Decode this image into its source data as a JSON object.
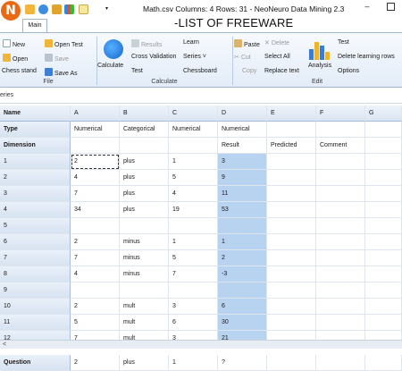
{
  "window": {
    "title": "Math.csv Columns: 4 Rows: 31 - NeoNeuro Data Mining 2.3",
    "app_icon_letter": "N",
    "minimize_glyph": "–",
    "banner": "-LIST OF FREEWARE"
  },
  "tabs": [
    {
      "label": "Main"
    }
  ],
  "ribbon": {
    "file": {
      "label": "File",
      "new": "New",
      "open_test": "Open Test",
      "open": "Open",
      "save": "Save",
      "chess_stand": "Chess stand",
      "save_as": "Save As"
    },
    "calculate": {
      "label": "Calculate",
      "calculate": "Calculate",
      "results": "Results",
      "cross_validation": "Cross Validation",
      "test": "Test",
      "learn": "Learn",
      "series": "Series ˅",
      "chessboard": "Chessboard"
    },
    "edit": {
      "label": "Edit",
      "paste": "Paste",
      "delete": "Delete",
      "cut": "Cut",
      "select_all": "Select All",
      "copy": "Copy",
      "replace_text": "Replace text",
      "analysis": "Analysis",
      "test": "Test",
      "delete_learning_rows": "Delete learning rows",
      "options": "Options"
    }
  },
  "formula_bar": {
    "text": "eries"
  },
  "grid": {
    "columns": [
      "Name",
      "A",
      "B",
      "C",
      "D",
      "E",
      "F",
      "G"
    ],
    "type_row": [
      "Type",
      "Numerical",
      "Categorical",
      "Numerical",
      "Numerical",
      "",
      "",
      ""
    ],
    "dimension_row": [
      "Dimension",
      "",
      "",
      "",
      "Result",
      "Predicted",
      "Comment",
      ""
    ],
    "rows": [
      [
        "1",
        "2",
        "plus",
        "1",
        "3"
      ],
      [
        "2",
        "4",
        "plus",
        "5",
        "9"
      ],
      [
        "3",
        "7",
        "plus",
        "4",
        "11"
      ],
      [
        "4",
        "34",
        "plus",
        "19",
        "53"
      ],
      [
        "5",
        "",
        "",
        "",
        ""
      ],
      [
        "6",
        "2",
        "minus",
        "1",
        "1"
      ],
      [
        "7",
        "7",
        "minus",
        "5",
        "2"
      ],
      [
        "8",
        "4",
        "minus",
        "7",
        "-3"
      ],
      [
        "9",
        "",
        "",
        "",
        ""
      ],
      [
        "10",
        "2",
        "mult",
        "3",
        "6"
      ],
      [
        "11",
        "5",
        "mult",
        "6",
        "30"
      ],
      [
        "12",
        "7",
        "mult",
        "3",
        "21"
      ]
    ],
    "question_row": [
      "Question",
      "2",
      "plus",
      "1",
      "?"
    ]
  },
  "scroll": {
    "left_arrow": "<"
  },
  "colors": {
    "accent": "#b8d3f0",
    "header": "#dae5f2",
    "app_icon": "#e86a14"
  }
}
